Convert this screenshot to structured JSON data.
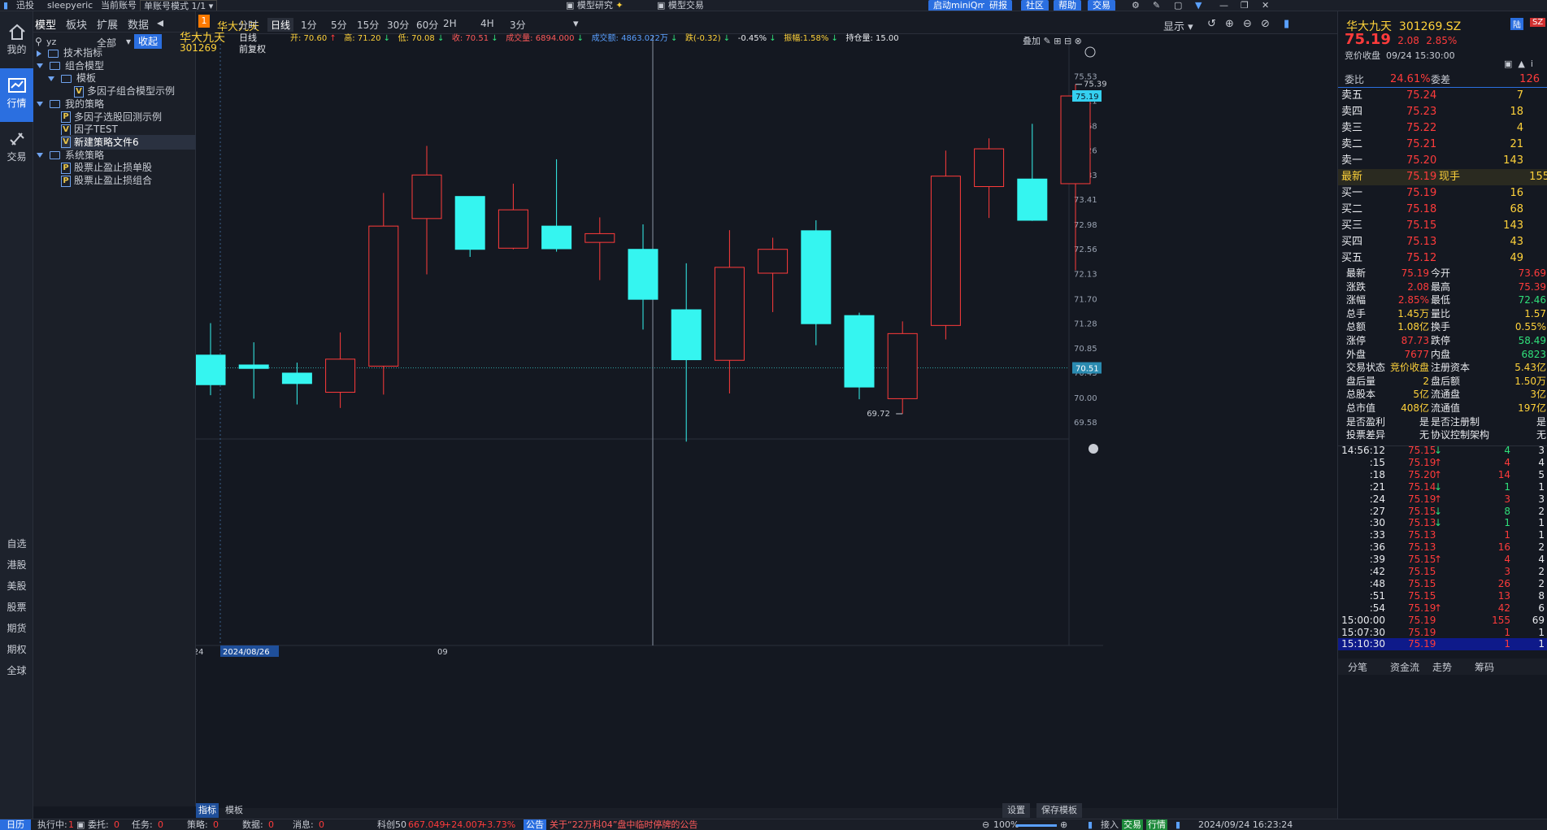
{
  "topbar": {
    "app_name": "迅投",
    "user": "sleepyeric",
    "account_label": "当前账号",
    "account_mode": "单账号模式 1/1",
    "tab_research": "模型研究",
    "tab_trade": "模型交易",
    "btn_miniqmt": "启动miniQmt",
    "btn_report": "研报",
    "btn_community": "社区",
    "btn_help": "帮助",
    "btn_trade": "交易"
  },
  "leftnav": {
    "items": [
      "我的",
      "行情",
      "交易"
    ],
    "markets": [
      "自选",
      "港股",
      "美股",
      "股票",
      "期货",
      "期权",
      "全球"
    ]
  },
  "tree": {
    "tabs": [
      "模型",
      "板块",
      "扩展",
      "数据"
    ],
    "search_value": "yz",
    "filter": "全部",
    "collapse": "收起",
    "rows": [
      {
        "label": "技术指标"
      },
      {
        "label": "组合模型"
      },
      {
        "label": "模板"
      },
      {
        "label": "多因子组合模型示例",
        "type": "V"
      },
      {
        "label": "我的策略"
      },
      {
        "label": "多因子选股回测示例",
        "type": "P"
      },
      {
        "label": "因子TEST",
        "type": "V"
      },
      {
        "label": "新建策略文件6",
        "type": "V"
      },
      {
        "label": "系统策略"
      },
      {
        "label": "股票止盈止损单股",
        "type": "P"
      },
      {
        "label": "股票止盈止损组合",
        "type": "P"
      }
    ]
  },
  "chart_header": {
    "badge": "1",
    "stock_tab": "华大九天",
    "periods": [
      "分时",
      "日线",
      "1分",
      "5分",
      "15分",
      "30分",
      "60分",
      "2H",
      "4H",
      "3分"
    ],
    "active_period": "日线",
    "display": "显示"
  },
  "infobar": {
    "name": "华大九天",
    "code": "301269",
    "period": "日线",
    "adjust": "前复权",
    "open": "开: 70.60",
    "high": "高: 71.20",
    "low": "低: 70.08",
    "close": "收: 70.51",
    "volume": "成交量: 6894.000",
    "amount": "成交额: 4863.022万",
    "change": "跌(-0.32)",
    "pct": "-0.45%",
    "amplitude": "振幅:1.58%",
    "position": "持仓量: 15.00",
    "overlay": "叠加"
  },
  "chart_data": {
    "type": "candlestick",
    "y_ticks": [
      "75.53",
      "75.11",
      "74.68",
      "74.26",
      "73.83",
      "73.41",
      "72.98",
      "72.56",
      "72.13",
      "71.70",
      "71.28",
      "70.85",
      "70.43",
      "70.00",
      "69.58"
    ],
    "ylim": [
      69.37,
      75.75
    ],
    "current_price": "75.19",
    "crosshair_price": "70.51",
    "max_label": "75.39",
    "min_label": "69.72",
    "x_labels": [
      "2024",
      "2024/08/26",
      "09"
    ],
    "candles": [
      {
        "o": 70.73,
        "h": 71.28,
        "l": 70.04,
        "c": 70.22
      },
      {
        "o": 70.56,
        "h": 70.95,
        "l": 69.98,
        "c": 70.5
      },
      {
        "o": 70.42,
        "h": 70.6,
        "l": 69.88,
        "c": 70.24
      },
      {
        "o": 70.09,
        "h": 71.12,
        "l": 69.82,
        "c": 70.66
      },
      {
        "o": 70.54,
        "h": 73.52,
        "l": 70.05,
        "c": 72.95
      },
      {
        "o": 73.08,
        "h": 74.33,
        "l": 72.12,
        "c": 73.83
      },
      {
        "o": 73.46,
        "h": 73.46,
        "l": 72.42,
        "c": 72.55
      },
      {
        "o": 72.57,
        "h": 73.68,
        "l": 72.55,
        "c": 73.23
      },
      {
        "o": 72.95,
        "h": 74.1,
        "l": 72.51,
        "c": 72.56
      },
      {
        "o": 72.67,
        "h": 73.1,
        "l": 72.02,
        "c": 72.82
      },
      {
        "o": 72.55,
        "h": 72.98,
        "l": 71.17,
        "c": 71.69
      },
      {
        "o": 71.51,
        "h": 72.31,
        "l": 69.24,
        "c": 70.65
      },
      {
        "o": 70.64,
        "h": 72.88,
        "l": 70.07,
        "c": 72.24
      },
      {
        "o": 72.14,
        "h": 72.75,
        "l": 71.47,
        "c": 72.55
      },
      {
        "o": 72.87,
        "h": 73.05,
        "l": 70.9,
        "c": 71.27
      },
      {
        "o": 71.41,
        "h": 71.46,
        "l": 69.97,
        "c": 70.18
      },
      {
        "o": 69.98,
        "h": 71.31,
        "l": 69.72,
        "c": 71.1
      },
      {
        "o": 71.24,
        "h": 74.25,
        "l": 71.0,
        "c": 73.81
      },
      {
        "o": 73.63,
        "h": 74.46,
        "l": 73.09,
        "c": 74.28
      },
      {
        "o": 73.76,
        "h": 74.71,
        "l": 73.04,
        "c": 73.05
      },
      {
        "o": 73.68,
        "h": 75.39,
        "l": 72.19,
        "c": 75.19
      }
    ]
  },
  "bottom": {
    "tab_indicator": "指标",
    "tab_template": "模板",
    "settings": "设置",
    "save_template": "保存模板"
  },
  "right": {
    "title": "华大九天",
    "code": "301269.SZ",
    "price": "75.19",
    "change": "2.08",
    "pct": "2.85%",
    "status": "竞价收盘",
    "datetime": "09/24  15:30:00",
    "weibi_label": "委比",
    "weibi": "24.61%",
    "weicha_label": "委差",
    "weicha": "126",
    "asks": [
      {
        "label": "卖五",
        "price": "75.24",
        "vol": "7"
      },
      {
        "label": "卖四",
        "price": "75.23",
        "vol": "18"
      },
      {
        "label": "卖三",
        "price": "75.22",
        "vol": "4"
      },
      {
        "label": "卖二",
        "price": "75.21",
        "vol": "21"
      },
      {
        "label": "卖一",
        "price": "75.20",
        "vol": "143"
      }
    ],
    "latest": {
      "label": "最新",
      "price": "75.19",
      "hand_label": "现手",
      "hand": "155"
    },
    "bids": [
      {
        "label": "买一",
        "price": "75.19",
        "vol": "16"
      },
      {
        "label": "买二",
        "price": "75.18",
        "vol": "68"
      },
      {
        "label": "买三",
        "price": "75.15",
        "vol": "143"
      },
      {
        "label": "买四",
        "price": "75.13",
        "vol": "43"
      },
      {
        "label": "买五",
        "price": "75.12",
        "vol": "49"
      }
    ],
    "stats": [
      {
        "l1": "最新",
        "v1": "75.19",
        "c1": "red",
        "l2": "今开",
        "v2": "73.69",
        "c2": "red"
      },
      {
        "l1": "涨跌",
        "v1": "2.08",
        "c1": "red",
        "l2": "最高",
        "v2": "75.39",
        "c2": "red"
      },
      {
        "l1": "涨幅",
        "v1": "2.85%",
        "c1": "red",
        "l2": "最低",
        "v2": "72.46",
        "c2": "grn"
      },
      {
        "l1": "总手",
        "v1": "1.45万",
        "c1": "yel",
        "l2": "量比",
        "v2": "1.57",
        "c2": "yel"
      },
      {
        "l1": "总额",
        "v1": "1.08亿",
        "c1": "yel",
        "l2": "换手",
        "v2": "0.55%",
        "c2": "yel"
      },
      {
        "l1": "涨停",
        "v1": "87.73",
        "c1": "red",
        "l2": "跌停",
        "v2": "58.49",
        "c2": "grn"
      },
      {
        "l1": "外盘",
        "v1": "7677",
        "c1": "red",
        "l2": "内盘",
        "v2": "6823",
        "c2": "grn"
      },
      {
        "l1": "交易状态",
        "v1": "竞价收盘",
        "c1": "yel",
        "l2": "注册资本",
        "v2": "5.43亿",
        "c2": "yel"
      },
      {
        "l1": "盘后量",
        "v1": "2",
        "c1": "yel",
        "l2": "盘后额",
        "v2": "1.50万",
        "c2": "yel"
      },
      {
        "l1": "总股本",
        "v1": "5亿",
        "c1": "yel",
        "l2": "流通盘",
        "v2": "3亿",
        "c2": "yel"
      },
      {
        "l1": "总市值",
        "v1": "408亿",
        "c1": "yel",
        "l2": "流通值",
        "v2": "197亿",
        "c2": "yel"
      },
      {
        "l1": "是否盈利",
        "v1": "是",
        "c1": "wht",
        "l2": "是否注册制",
        "v2": "是",
        "c2": "wht"
      },
      {
        "l1": "投票差异",
        "v1": "无",
        "c1": "wht",
        "l2": "协议控制架构",
        "v2": "无",
        "c2": "wht"
      }
    ],
    "ticks": [
      {
        "t": "14:56:12",
        "p": "75.15",
        "d": "down",
        "v": "4",
        "n": "3"
      },
      {
        "t": ":15",
        "p": "75.19",
        "d": "up",
        "v": "4",
        "n": "4"
      },
      {
        "t": ":18",
        "p": "75.20",
        "d": "up",
        "v": "14",
        "n": "5"
      },
      {
        "t": ":21",
        "p": "75.14",
        "d": "down",
        "v": "1",
        "n": "1"
      },
      {
        "t": ":24",
        "p": "75.19",
        "d": "up",
        "v": "3",
        "n": "3"
      },
      {
        "t": ":27",
        "p": "75.15",
        "d": "down",
        "v": "8",
        "n": "2"
      },
      {
        "t": ":30",
        "p": "75.13",
        "d": "down",
        "v": "1",
        "n": "1"
      },
      {
        "t": ":33",
        "p": "75.13",
        "d": "",
        "v": "1",
        "n": "1"
      },
      {
        "t": ":36",
        "p": "75.13",
        "d": "",
        "v": "16",
        "n": "2"
      },
      {
        "t": ":39",
        "p": "75.15",
        "d": "up",
        "v": "4",
        "n": "4"
      },
      {
        "t": ":42",
        "p": "75.15",
        "d": "",
        "v": "3",
        "n": "2"
      },
      {
        "t": ":48",
        "p": "75.15",
        "d": "",
        "v": "26",
        "n": "2"
      },
      {
        "t": ":51",
        "p": "75.15",
        "d": "",
        "v": "13",
        "n": "8"
      },
      {
        "t": ":54",
        "p": "75.19",
        "d": "up",
        "v": "42",
        "n": "6"
      },
      {
        "t": "15:00:00",
        "p": "75.19",
        "d": "",
        "v": "155",
        "n": "69"
      },
      {
        "t": "15:07:30",
        "p": "75.19",
        "d": "",
        "v": "1",
        "n": "1"
      },
      {
        "t": "15:10:30",
        "p": "75.19",
        "d": "",
        "v": "1",
        "n": "1"
      }
    ],
    "bottom_tabs": [
      "分笔",
      "资金流",
      "走势",
      "筹码"
    ]
  },
  "statusbar": {
    "calendar": "日历",
    "running": "执行中:",
    "running_n": "1",
    "entrust": "委托:",
    "entrust_n": "0",
    "task": "任务:",
    "task_n": "0",
    "strategy": "策略:",
    "strategy_n": "0",
    "data": "数据:",
    "data_n": "0",
    "msg": "消息:",
    "msg_n": "0",
    "index_name": "科创50",
    "index_val": "667.049",
    "index_chg": "+24.007",
    "index_pct": "+3.73%",
    "notice_label": "公告",
    "notice": "关于“22万科04”盘中临时停牌的公告",
    "zoom": "100%",
    "access": "接入",
    "trade": "交易",
    "market": "行情",
    "datetime": "2024/09/24 16:23:24"
  },
  "colors": {
    "up": "#ff3b3b",
    "down": "#35f5f0",
    "bg": "#141821",
    "accent": "#2b6fe0"
  }
}
